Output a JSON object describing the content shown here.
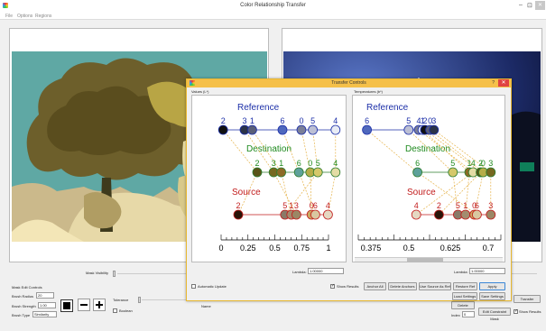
{
  "window": {
    "title": "Color Relationship Transfer",
    "minimize_glyph": "–",
    "restore_glyph": "⊡",
    "close_glyph": "✕"
  },
  "menu": [
    "File",
    "Options",
    "Regions"
  ],
  "main": {
    "mask_visibility_label": "Mask Visibility",
    "mask_edit_controls_label": "Mask Edit Controls",
    "brush_radius_label": "Brush Radius",
    "brush_radius_value": "20",
    "brush_strength_label": "Brush Strength",
    "brush_strength_value": "1.00",
    "brush_type_label": "Brush Type",
    "brush_type_value": "Similarity",
    "tolerance_label": "Tolerance",
    "boolean_label": "Boolean",
    "name_label": "Name",
    "index_label": "Index",
    "index_value": "0",
    "edit_constraint_mask_label": "Edit Constraint Mask",
    "show_results_label": "Show Results",
    "transfer_label": "Transfer",
    "delete_label": "Delete",
    "add_label": "Add"
  },
  "dialog": {
    "title": "Transfer Controls",
    "help_glyph": "?",
    "close_glyph": "✕",
    "left_panel_title": "Values (L*)",
    "right_panel_title": "Temperatures (b*)",
    "reference_label": "Reference",
    "destination_label": "Destination",
    "source_label": "Source",
    "lambda_label": "Lambda:",
    "lambda_left_value": "1.00000",
    "lambda_right_value": "1.00000",
    "automatic_update_label": "Automatic Update",
    "show_results_label": "Show Results",
    "buttons": [
      "Anchor All",
      "Delete Anchors",
      "Use Source As Ref",
      "Restore Ref",
      "Apply"
    ],
    "buttons2": [
      "Load Settings",
      "Save Settings"
    ]
  },
  "colors": {
    "reference_text": "#1c2fa8",
    "destination_text": "#1f8a1f",
    "source_text": "#c21c1c",
    "dialog_title_bg": "#f5c04a",
    "image_bg_teal": "#5fa8a4"
  },
  "chart_data": [
    {
      "type": "scatter",
      "title": "Values (L*)",
      "x_ticks": [
        "0",
        "0.25",
        "0.5",
        "0.75",
        "1"
      ],
      "xlim": [
        0,
        1
      ],
      "rows": {
        "reference": {
          "labels": [
            "2",
            "3",
            "1",
            "6",
            "0",
            "5",
            "4"
          ],
          "x": [
            0.03,
            0.2,
            0.26,
            0.5,
            0.65,
            0.74,
            0.92
          ],
          "colors": [
            "#111111",
            "#2b3348",
            "#5a5f78",
            "#4f68bd",
            "#7b7f98",
            "#bcbfd4",
            "#e8ecf5"
          ]
        },
        "destination": {
          "labels": [
            "2",
            "3",
            "1",
            "6",
            "0",
            "5",
            "4"
          ],
          "x": [
            0.3,
            0.43,
            0.49,
            0.63,
            0.72,
            0.78,
            0.92
          ],
          "colors": [
            "#5a5418",
            "#76681f",
            "#8d6a25",
            "#5ea19a",
            "#b6ad48",
            "#d5c86a",
            "#e4dca4"
          ]
        },
        "source": {
          "labels": [
            "2",
            "5",
            "1",
            "3",
            "0",
            "6",
            "4"
          ],
          "x": [
            0.15,
            0.52,
            0.57,
            0.61,
            0.73,
            0.76,
            0.86
          ],
          "colors": [
            "#2a1408",
            "#8a7a68",
            "#a48c70",
            "#9b8765",
            "#caa860",
            "#d9c7a0",
            "#e5d8c2"
          ]
        }
      }
    },
    {
      "type": "scatter",
      "title": "Temperatures (b*)",
      "x_ticks": [
        "0.375",
        "0.5",
        "0.625",
        "0.7"
      ],
      "rows": {
        "reference": {
          "labels": [
            "6",
            "5",
            "4",
            "1",
            "2",
            "0",
            "3"
          ],
          "x": [
            0.04,
            0.37,
            0.45,
            0.48,
            0.5,
            0.54,
            0.57
          ],
          "colors": [
            "#4f68bd",
            "#bcbfd4",
            "#7b7f98",
            "#e8ecf5",
            "#111111",
            "#5a5f78",
            "#2b3348"
          ]
        },
        "destination": {
          "labels": [
            "6",
            "5",
            "1",
            "4",
            "2",
            "0",
            "3"
          ],
          "x": [
            0.44,
            0.72,
            0.85,
            0.88,
            0.94,
            0.96,
            1.02
          ],
          "colors": [
            "#5ea19a",
            "#d5c86a",
            "#8d6a25",
            "#e4dca4",
            "#5a5418",
            "#b6ad48",
            "#76681f"
          ]
        },
        "source": {
          "labels": [
            "4",
            "2",
            "5",
            "1",
            "0",
            "6",
            "3"
          ],
          "x": [
            0.43,
            0.61,
            0.76,
            0.82,
            0.89,
            0.91,
            1.02
          ],
          "colors": [
            "#e5d8c2",
            "#2a1408",
            "#8a7a68",
            "#a48c70",
            "#caa860",
            "#d9c7a0",
            "#9b8765"
          ]
        }
      }
    }
  ]
}
